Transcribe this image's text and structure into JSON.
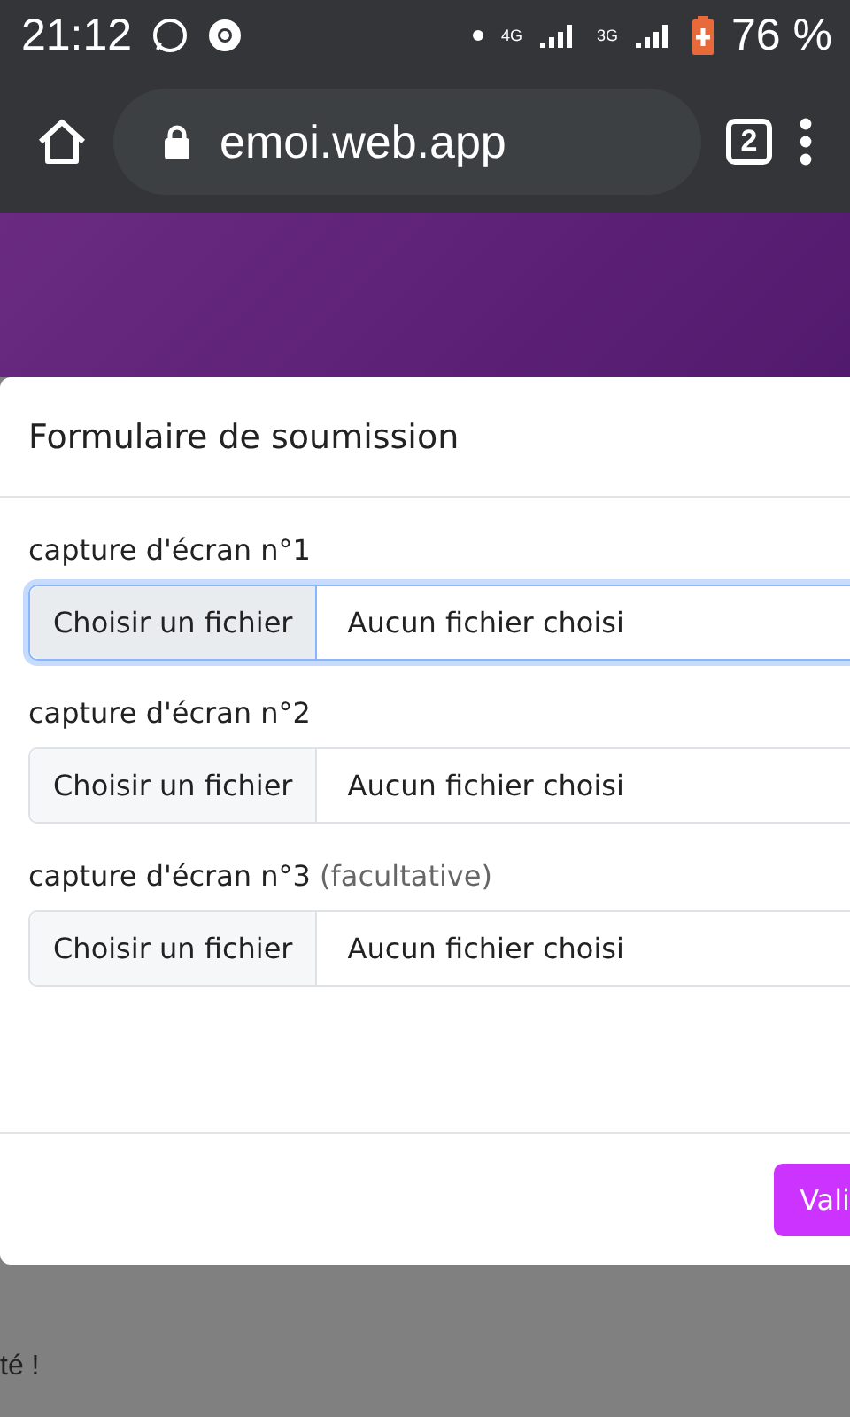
{
  "status_bar": {
    "time": "21:12",
    "network_1": "4G",
    "network_2": "3G",
    "battery": "76 %"
  },
  "browser": {
    "url": "emoi.web.app",
    "tab_count": "2"
  },
  "modal": {
    "title": "Formulaire de soumission",
    "fields": [
      {
        "label": "capture d'écran n°1",
        "button": "Choisir un fichier",
        "value": "Aucun fichier choisi",
        "focused": true
      },
      {
        "label": "capture d'écran n°2",
        "button": "Choisir un fichier",
        "value": "Aucun fichier choisi",
        "focused": false
      },
      {
        "label": "capture d'écran n°3",
        "note": "(facultative)",
        "button": "Choisir un fichier",
        "value": "Aucun fichier choisi",
        "focused": false
      }
    ],
    "submit": "Vali"
  },
  "background_text": "té !"
}
